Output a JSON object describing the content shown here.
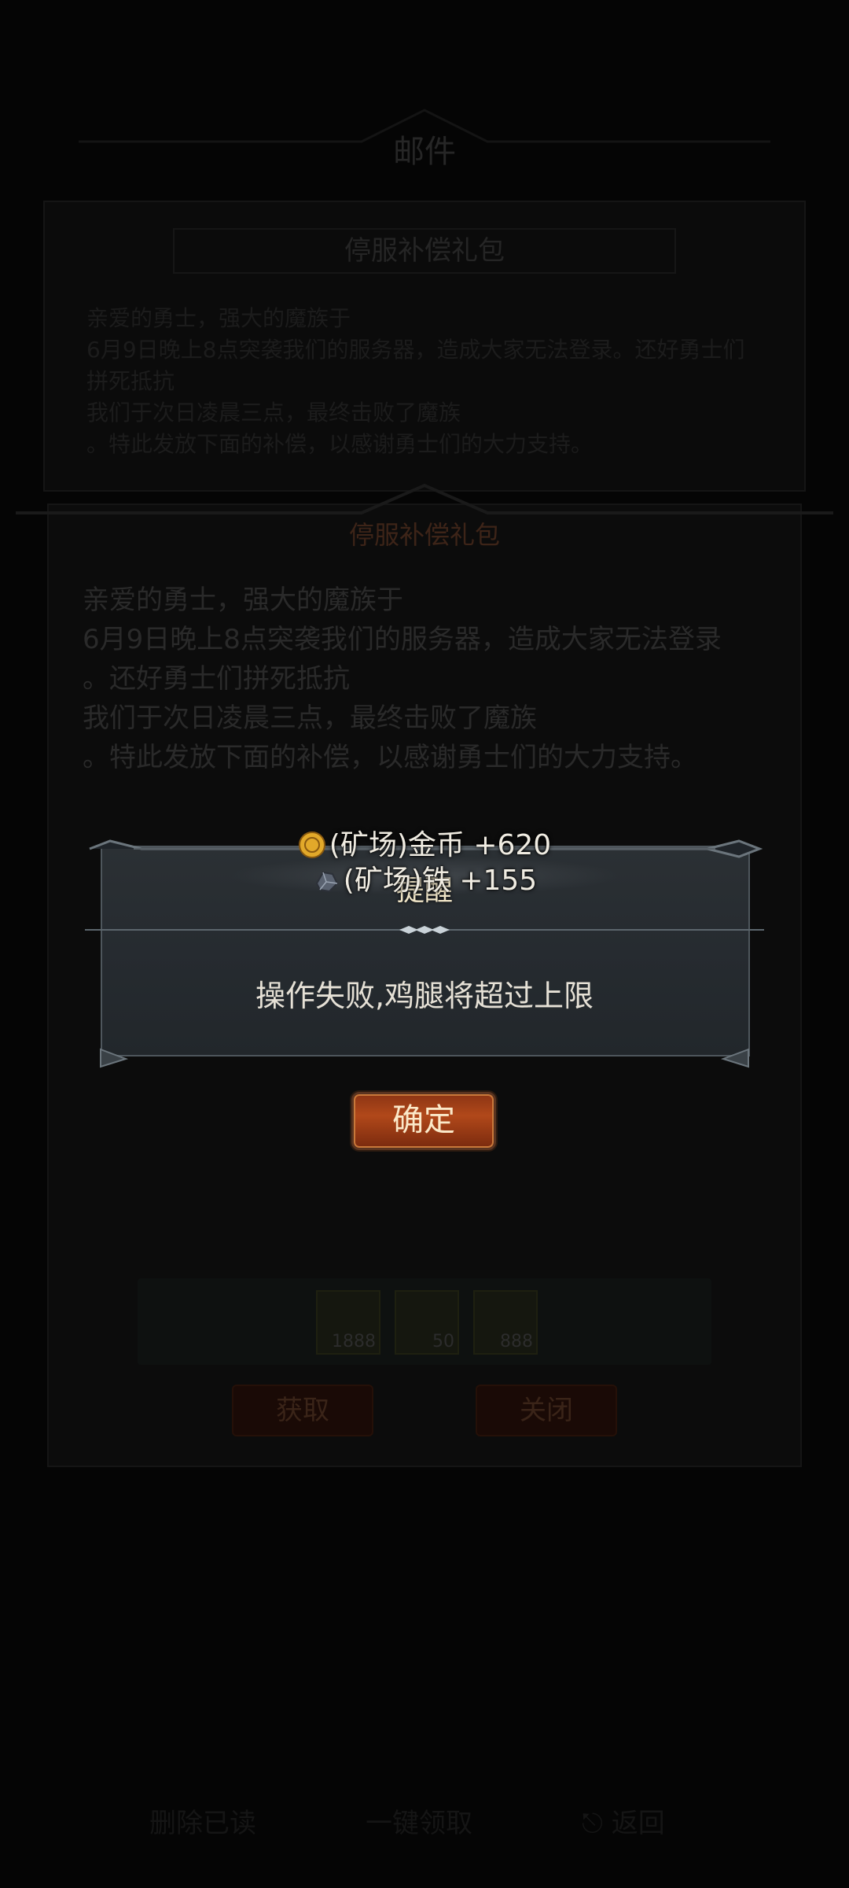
{
  "background": {
    "mail_title": "邮件",
    "list_row_title": "停服补偿礼包",
    "list_text": [
      "亲爱的勇士，强大的魔族于",
      "6月9日晚上8点突袭我们的服务器，造成大家无法登录。还好勇士们拼死抵抗",
      "我们于次日凌晨三点，最终击败了魔族",
      "。特此发放下面的补偿，以感谢勇士们的大力支持。"
    ],
    "detail": {
      "title": "停服补偿礼包",
      "body": [
        "亲爱的勇士，强大的魔族于",
        "6月9日晚上8点突袭我们的服务器，造成大家无法登录",
        "。还好勇士们拼死抵抗",
        "我们于次日凌晨三点，最终击败了魔族",
        "。特此发放下面的补偿，以感谢勇士们的大力支持。"
      ],
      "items": [
        {
          "icon": "crystal-icon",
          "count": "1888"
        },
        {
          "icon": "drumstick-icon",
          "count": "50"
        },
        {
          "icon": "fire-stone-icon",
          "count": "888"
        }
      ],
      "get_label": "获取",
      "close_label": "关闭"
    },
    "footer": {
      "delete_read": "删除已读",
      "claim_all": "一键领取",
      "back": "返回"
    }
  },
  "toasts": [
    {
      "icon": "gold-coin-icon",
      "text": "(矿场)金币 +620"
    },
    {
      "icon": "iron-ore-icon",
      "text": "(矿场)铁 +155"
    }
  ],
  "dialog": {
    "title": "提醒",
    "message": "操作失败,鸡腿将超过上限",
    "confirm_label": "确定"
  },
  "colors": {
    "accent": "#b1481a",
    "dialog_bg": "#282d32",
    "text": "#e6e1d6"
  }
}
